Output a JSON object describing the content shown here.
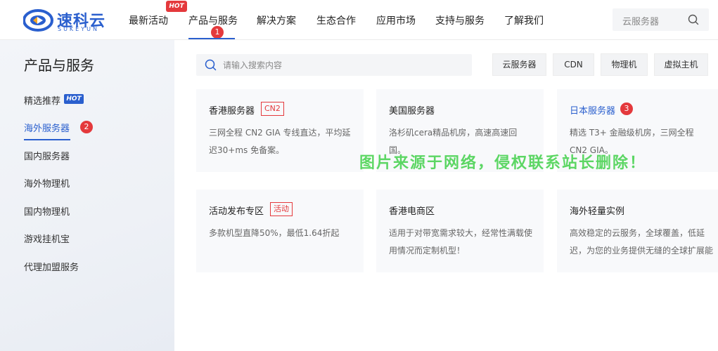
{
  "brand": {
    "name": "速科云",
    "sub": "SUKEYUN",
    "color": "#2a5fce"
  },
  "nav": {
    "items": [
      {
        "label": "最新活动"
      },
      {
        "label": "产品与服务"
      },
      {
        "label": "解决方案"
      },
      {
        "label": "生态合作"
      },
      {
        "label": "应用市场"
      },
      {
        "label": "支持与服务"
      },
      {
        "label": "了解我们"
      }
    ],
    "hot_label": "HOT",
    "active_badge": "1",
    "search_placeholder": "云服务器"
  },
  "sidebar": {
    "title": "产品与服务",
    "hot_label": "HOT",
    "active_badge": "2",
    "items": [
      {
        "label": "精选推荐"
      },
      {
        "label": "海外服务器"
      },
      {
        "label": "国内服务器"
      },
      {
        "label": "海外物理机"
      },
      {
        "label": "国内物理机"
      },
      {
        "label": "游戏挂机宝"
      },
      {
        "label": "代理加盟服务"
      }
    ]
  },
  "main": {
    "search_placeholder": "请输入搜索内容",
    "quick_links": [
      "云服务器",
      "CDN",
      "物理机",
      "虚拟主机"
    ],
    "cards": [
      {
        "title": "香港服务器",
        "tag": "CN2",
        "desc": "三网全程 CN2 GIA 专线直达，平均延迟30+ms 免备案。"
      },
      {
        "title": "美国服务器",
        "desc": "洛杉矶cera精品机房，高速高速回国。"
      },
      {
        "title": "日本服务器",
        "badge": "3",
        "desc": "精选 T3+ 金融级机房，三网全程 CN2 GIA。"
      },
      {
        "title": "活动发布专区",
        "tag": "活动",
        "desc": "多款机型直降50%，最低1.64折起"
      },
      {
        "title": "香港电商区",
        "desc": "适用于对带宽需求较大，经常性满载使用情况而定制机型！"
      },
      {
        "title": "海外轻量实例",
        "desc": "高效稳定的云服务，全球覆盖，低延迟，为您的业务提供无缝的全球扩展能力"
      }
    ]
  },
  "watermark": "图片来源于网络，侵权联系站长删除！",
  "colors": {
    "accent": "#2a5fce",
    "badge": "#e4393c",
    "watermark": "#41d14a"
  }
}
